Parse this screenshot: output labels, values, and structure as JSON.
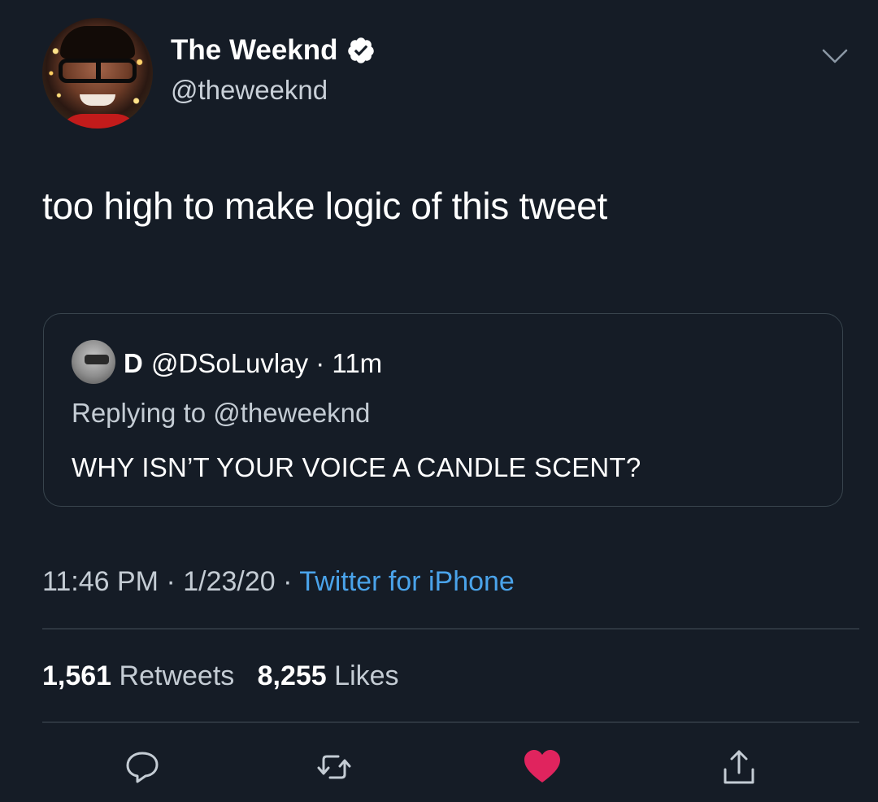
{
  "author": {
    "display_name": "The Weeknd",
    "handle": "@theweeknd",
    "verified": true
  },
  "tweet": {
    "text": "too high to make logic of this tweet"
  },
  "quoted_tweet": {
    "name": "D",
    "handle_time": "@DSoLuvlay · 11m",
    "replying_to": "Replying to @theweeknd",
    "text": "WHY ISN’T YOUR VOICE A CANDLE SCENT?"
  },
  "meta": {
    "time_date": "11:46 PM · 1/23/20 · ",
    "source": "Twitter for iPhone"
  },
  "stats": {
    "retweets_count": "1,561",
    "retweets_label": "Retweets",
    "likes_count": "8,255",
    "likes_label": "Likes"
  },
  "actions": {
    "reply_icon": "reply-icon",
    "retweet_icon": "retweet-icon",
    "like_icon": "heart-icon",
    "share_icon": "share-icon"
  },
  "colors": {
    "background": "#151c26",
    "link": "#4aa3ea",
    "like": "#e0245e"
  }
}
